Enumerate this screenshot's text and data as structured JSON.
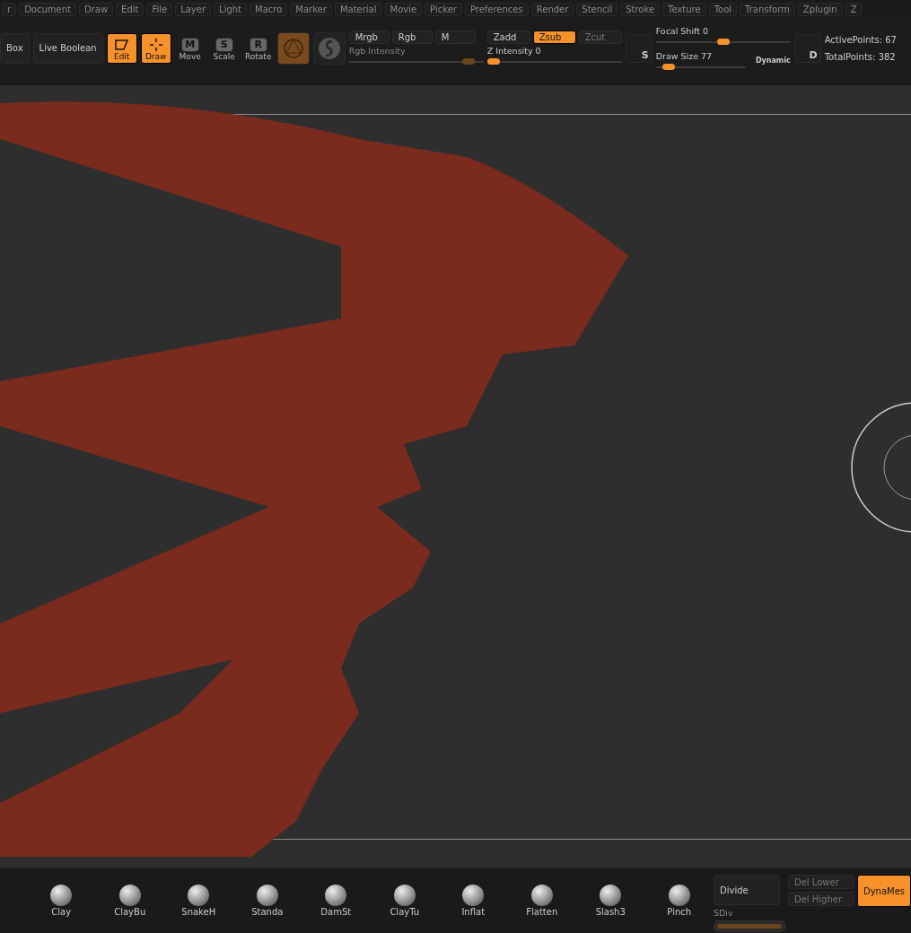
{
  "menu": [
    "r",
    "Document",
    "Draw",
    "Edit",
    "File",
    "Layer",
    "Light",
    "Macro",
    "Marker",
    "Material",
    "Movie",
    "Picker",
    "Preferences",
    "Render",
    "Stencil",
    "Stroke",
    "Texture",
    "Tool",
    "Transform",
    "Zplugin",
    "Z"
  ],
  "toolbar": {
    "left_buttons": [
      {
        "label": "Box"
      },
      {
        "label": "Live Boolean"
      }
    ],
    "modes": [
      {
        "label": "Edit",
        "kind": "edit",
        "selected": true
      },
      {
        "label": "Draw",
        "kind": "draw",
        "selected": true
      },
      {
        "label": "Move",
        "key": "M",
        "kind": "move",
        "selected": false
      },
      {
        "label": "Scale",
        "key": "S",
        "kind": "scale",
        "selected": false
      },
      {
        "label": "Rotate",
        "key": "R",
        "kind": "rotate",
        "selected": false
      }
    ],
    "color_modes": [
      {
        "label": "Mrgb",
        "selected": false
      },
      {
        "label": "Rgb",
        "selected": false
      },
      {
        "label": "M",
        "selected": false
      }
    ],
    "rgb_intensity": {
      "label": "Rgb Intensity",
      "level": 0.93,
      "disabled": true
    },
    "depth_modes": [
      {
        "label": "Zadd",
        "selected": false,
        "disabled": false
      },
      {
        "label": "Zsub",
        "selected": true,
        "disabled": false
      },
      {
        "label": "Zcut",
        "selected": false,
        "disabled": true
      }
    ],
    "z_intensity": {
      "label": "Z Intensity",
      "reading": "0",
      "level": 0.0
    },
    "stroke_key": "S",
    "focal_shift": {
      "label": "Focal Shift",
      "reading": "0",
      "level": 0.5
    },
    "draw_size": {
      "label": "Draw Size",
      "reading": "77",
      "level": 0.08
    },
    "dynamic": {
      "label": "Dynamic"
    },
    "draw_key": "D",
    "stats": [
      "ActivePoints: 67",
      "TotalPoints: 382"
    ]
  },
  "brushes": [
    "Clay",
    "ClayBu",
    "SnakeH",
    "Standa",
    "DamSt",
    "ClayTu",
    "Inflat",
    "Flatten",
    "Slash3",
    "Pinch"
  ],
  "geometry": {
    "divide": "Divide",
    "del_lower": {
      "label": "Del Lower",
      "disabled": true
    },
    "del_higher": {
      "label": "Del Higher",
      "disabled": true
    },
    "dynamesh": {
      "label": "DynaMes",
      "selected": true
    },
    "sdiv": {
      "label": "SDiv",
      "level": 1.0
    }
  }
}
